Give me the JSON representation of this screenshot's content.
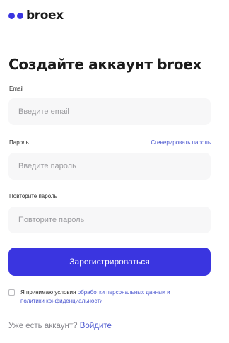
{
  "logo": {
    "brand": "broex",
    "dot_color": "#3a35e0"
  },
  "page_title": "Создайте аккаунт broex",
  "form": {
    "email": {
      "label": "Email",
      "placeholder": "Введите email",
      "value": ""
    },
    "password": {
      "label": "Пароль",
      "placeholder": "Введите пароль",
      "value": "",
      "generate_link": "Сгенерировать пароль"
    },
    "repeat_password": {
      "label": "Повторите пароль",
      "placeholder": "Повторите пароль",
      "value": ""
    },
    "submit_label": "Зарегистрироваться"
  },
  "consent": {
    "checked": false,
    "text_prefix": "Я принимаю условия ",
    "link_text": "обработки персональных данных и политики конфиденциальности"
  },
  "login": {
    "question": "Уже есть аккаунт?",
    "link_text": "Войдите"
  },
  "colors": {
    "accent": "#3a35e0",
    "link": "#4a56cf",
    "input_bg": "#f7f7f8",
    "text": "#1c1c1c",
    "muted": "#8a8a90"
  }
}
